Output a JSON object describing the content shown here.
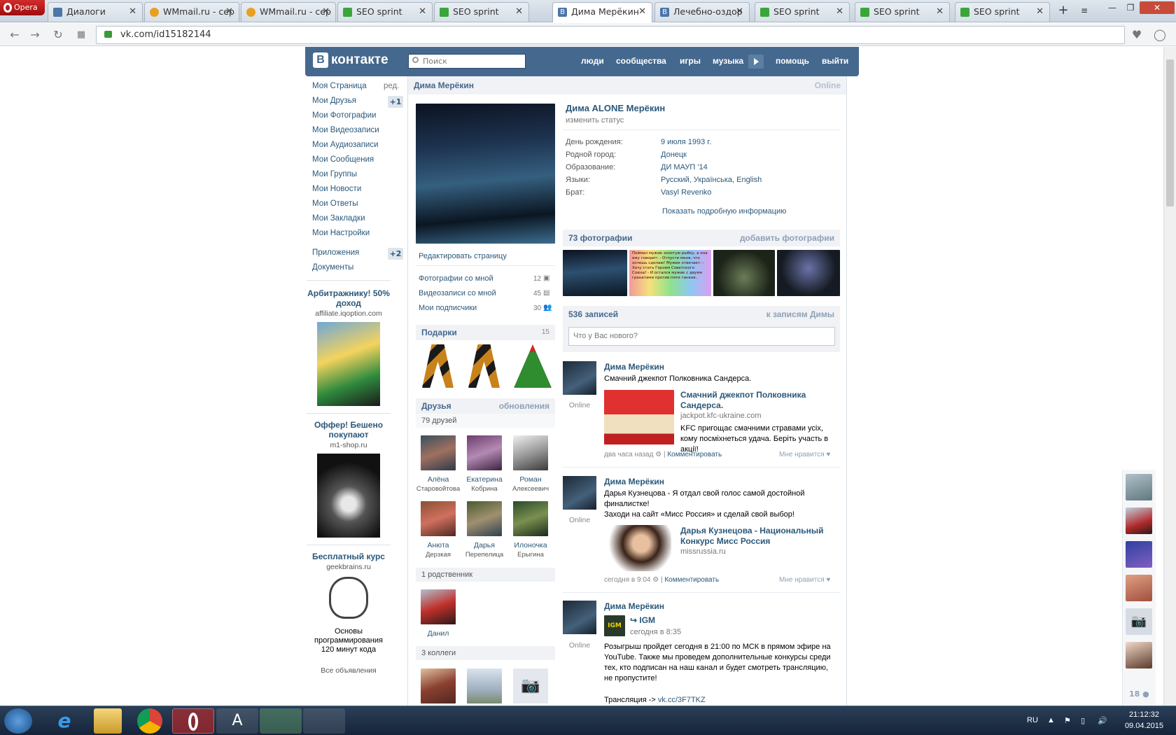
{
  "browser": {
    "name": "Opera",
    "tabs": [
      {
        "label": "Диалоги",
        "fav": "#4a76a8",
        "fav_icon": "vk-icon"
      },
      {
        "label": "WMmail.ru - сер",
        "fav": "#e8a020",
        "fav_icon": "wmmail-icon"
      },
      {
        "label": "WMmail.ru - сер",
        "fav": "#e8a020",
        "fav_icon": "wmmail-icon"
      },
      {
        "label": "SEO sprint",
        "fav": "#3aa63a",
        "fav_icon": "seosprint-icon"
      },
      {
        "label": "SEO sprint",
        "fav": "#3aa63a",
        "fav_icon": "seosprint-icon"
      },
      {
        "label": "Дима Мерёкин",
        "fav": "#4a76a8",
        "fav_icon": "vk-icon",
        "active": true
      },
      {
        "label": "Лечебно-оздор",
        "fav": "#4a76a8",
        "fav_icon": "vk-icon"
      },
      {
        "label": "SEO sprint",
        "fav": "#3aa63a",
        "fav_icon": "seosprint-icon"
      },
      {
        "label": "SEO sprint",
        "fav": "#3aa63a",
        "fav_icon": "seosprint-icon"
      },
      {
        "label": "SEO sprint",
        "fav": "#3aa63a",
        "fav_icon": "seosprint-icon"
      }
    ],
    "url": "vk.com/id15182144"
  },
  "vk": {
    "logo": "контакте",
    "search_placeholder": "Поиск",
    "topnav": [
      "люди",
      "сообщества",
      "игры",
      "музыка",
      "помощь",
      "выйти"
    ],
    "left_menu": [
      "Моя Страница",
      "Мои Друзья",
      "Мои Фотографии",
      "Мои Видеозаписи",
      "Мои Аудиозаписи",
      "Мои Сообщения",
      "Мои Группы",
      "Мои Новости",
      "Мои Ответы",
      "Мои Закладки",
      "Мои Настройки"
    ],
    "edit": "ред.",
    "friends_badge": "+1",
    "apps": "Приложения",
    "apps_badge": "+2",
    "docs": "Документы",
    "ads": [
      {
        "title": "Арбитражнику! 50% доход",
        "domain": "affiliate.iqoption.com"
      },
      {
        "title": "Оффер! Бешено покупают",
        "domain": "m1-shop.ru"
      },
      {
        "title": "Бесплатный курс",
        "domain": "geekbrains.ru",
        "text": "Основы программирования 120 минут кода"
      }
    ],
    "all_ads": "Все объявления",
    "profile": {
      "header_name": "Дима Мерёкин",
      "online": "Online",
      "full_name": "Дима ALONE Мерёкин",
      "status": "изменить статус",
      "info": [
        {
          "label": "День рождения:",
          "value": "9 июля 1993 г."
        },
        {
          "label": "Родной город:",
          "value": "Донецк"
        },
        {
          "label": "Образование:",
          "value": "ДИ МАУП '14"
        },
        {
          "label": "Языки:",
          "value": "Русский, Українська, English"
        },
        {
          "label": "Брат:",
          "value": "Vasyl Revenko"
        }
      ],
      "show_more": "Показать подробную информацию",
      "edit_page": "Редактировать страницу",
      "links": [
        {
          "label": "Фотографии со мной",
          "count": "12"
        },
        {
          "label": "Видеозаписи со мной",
          "count": "45"
        },
        {
          "label": "Мои подписчики",
          "count": "30"
        }
      ],
      "gifts": {
        "title": "Подарки",
        "count": "15"
      },
      "friends": {
        "title": "Друзья",
        "updates": "обновления",
        "count": "79 друзей",
        "list": [
          {
            "first": "Алёна",
            "last": "Старовойтова"
          },
          {
            "first": "Екатерина",
            "last": "Кобрина"
          },
          {
            "first": "Роман",
            "last": "Алексеевич"
          },
          {
            "first": "Анюта",
            "last": "Дерзкая"
          },
          {
            "first": "Дарья",
            "last": "Перепелица"
          },
          {
            "first": "Илоночка",
            "last": "Ерыгина"
          }
        ]
      },
      "relatives": {
        "title": "1 родственник",
        "name": "Данил"
      },
      "colleagues": "3 коллеги",
      "photos": {
        "title": "73 фотографии",
        "add": "добавить фотографии",
        "meme": "Поймал мужик золотую рыбку, а она ему говорит: - Отпусти меня, что хочешь сделаю! Мужик отвечает: - Хочу стать Героем Советского Союза! - И остался мужик с двумя гранатами против пяти танков.."
      },
      "wall": {
        "title": "536 записей",
        "link": "к записям Димы",
        "placeholder": "Что у Вас нового?"
      },
      "posts": [
        {
          "author": "Дима Мерёкин",
          "text": "Смачний джекпот Полковника Сандерса.",
          "link_title": "Смачний джекпот Полковника Сандерса.",
          "link_domain": "jackpot.kfc-ukraine.com",
          "link_text": "KFC пригощає смачними стравами усіх, кому посміхнеться удача. Беріть участь в акції!",
          "time": "два часа назад",
          "comment": "Комментировать",
          "like": "Мне нравится",
          "online": "Online"
        },
        {
          "author": "Дима Мерёкин",
          "text1": "Дарья Кузнецова - Я отдал свой голос самой достойной финалистке!",
          "text2": "Заходи на сайт «Мисс Россия» и сделай свой выбор!",
          "link_title": "Дарья Кузнецова - Национальный Конкурс Мисс Россия",
          "link_domain": "missrussia.ru",
          "time": "сегодня в 9:04",
          "comment": "Комментировать",
          "like": "Мне нравится",
          "online": "Online"
        },
        {
          "author": "Дима Мерёкин",
          "repost": "IGM",
          "repost_time": "сегодня в 8:35",
          "text": "Розыгрыш пройдет сегодня в 21:00 по МСК в прямом эфире на YouTube. Также мы проведем дополнительные конкурсы среди тех, кто подписан на наш канал и будет смотреть трансляцию, не пропустите!",
          "stream": "Трансляция -> ",
          "stream_link": "vk.cc/3F7TKZ",
          "online": "Online"
        }
      ],
      "right_count": "18"
    }
  },
  "taskbar": {
    "lang": "RU",
    "time": "21:12:32",
    "date": "09.04.2015"
  }
}
